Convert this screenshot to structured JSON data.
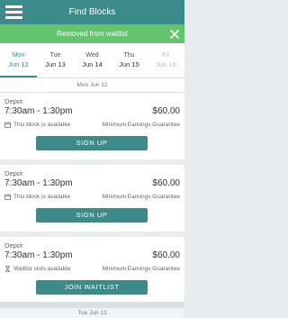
{
  "header": {
    "title": "Find Blocks",
    "menu_icon": "hamburger-menu-icon"
  },
  "banner": {
    "message": "Removed from waitlist",
    "close_icon": "close-icon",
    "color": "#63c36f"
  },
  "theme": {
    "accent": "#3c8a8a"
  },
  "days": [
    {
      "name": "Mon",
      "date": "Jun 12",
      "state": "active"
    },
    {
      "name": "Tue",
      "date": "Jun 13",
      "state": "normal"
    },
    {
      "name": "Wed",
      "date": "Jun 14",
      "state": "normal"
    },
    {
      "name": "Thu",
      "date": "Jun 15",
      "state": "normal"
    },
    {
      "name": "Fri",
      "date": "Jun 16",
      "state": "disabled"
    }
  ],
  "sections": [
    {
      "date_label": "Mon Jun 12"
    },
    {
      "date_label": "Tue Jun 13"
    }
  ],
  "blocks": [
    {
      "location": "Depot",
      "time": "7:30am - 1:30pm",
      "price": "$60.00",
      "status": "This block is available",
      "status_icon": "calendar-icon",
      "guarantee": "Minimum Earnings Guarantee",
      "action": "SIGN UP"
    },
    {
      "location": "Depot",
      "time": "7:30am - 1:30pm",
      "price": "$60.00",
      "status": "This block is available",
      "status_icon": "calendar-icon",
      "guarantee": "Minimum Earnings Guarantee",
      "action": "SIGN UP"
    },
    {
      "location": "Depot",
      "time": "7:30am - 1:30pm",
      "price": "$60.00",
      "status": "Waitlist slots available",
      "status_icon": "hourglass-icon",
      "guarantee": "Minimum Earnings Guarantee",
      "action": "JOIN WAITLIST"
    }
  ]
}
